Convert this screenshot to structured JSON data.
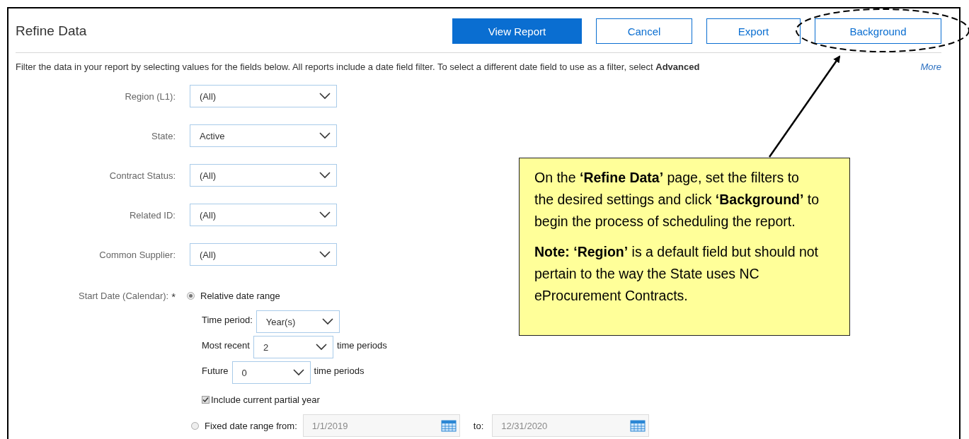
{
  "header": {
    "title": "Refine Data",
    "buttons": [
      {
        "label": "View Report",
        "kind": "primary"
      },
      {
        "label": "Cancel",
        "kind": "secondary"
      },
      {
        "label": "Export",
        "kind": "secondary"
      },
      {
        "label": "Background",
        "kind": "secondary"
      }
    ]
  },
  "description": {
    "text": "Filter the data in your report by selecting values for the fields below. All reports include a date field filter. To select a different date field to use as a filter, select **Advanced**",
    "link": "More"
  },
  "filters": [
    {
      "label": "Region (L1):",
      "value": "(All)"
    },
    {
      "label": "State:",
      "value": "Active"
    },
    {
      "label": "Contract Status:",
      "value": "(All)"
    },
    {
      "label": "Related ID:",
      "value": "(All)"
    },
    {
      "label": "Common Supplier:",
      "value": "(All)"
    }
  ],
  "start_date": {
    "label": "Start Date (Calendar):",
    "required_mark": "*",
    "relative": {
      "label": "Relative date range",
      "selected": true
    },
    "time_period": {
      "label": "Time period:",
      "value": "Year(s)"
    },
    "most_recent": {
      "label": "Most recent",
      "value": "2",
      "suffix": "time periods"
    },
    "future": {
      "label": "Future",
      "value": "0",
      "suffix": "time periods"
    },
    "include_partial": {
      "label": "Include current partial year",
      "checked": true
    },
    "fixed": {
      "label": "Fixed date range from:",
      "selected": false,
      "from": "1/1/2019",
      "to_label": "to:",
      "to": "12/31/2020",
      "disabled": true
    }
  },
  "callout": {
    "paragraphs": [
      "On the **‘Refine Data’** page, set the filters to the desired settings and click **‘Background’** to begin the process of scheduling the report.",
      "**Note: ‘Region’** is a default field but should not pertain to the way the State uses NC eProcurement Contracts."
    ]
  }
}
